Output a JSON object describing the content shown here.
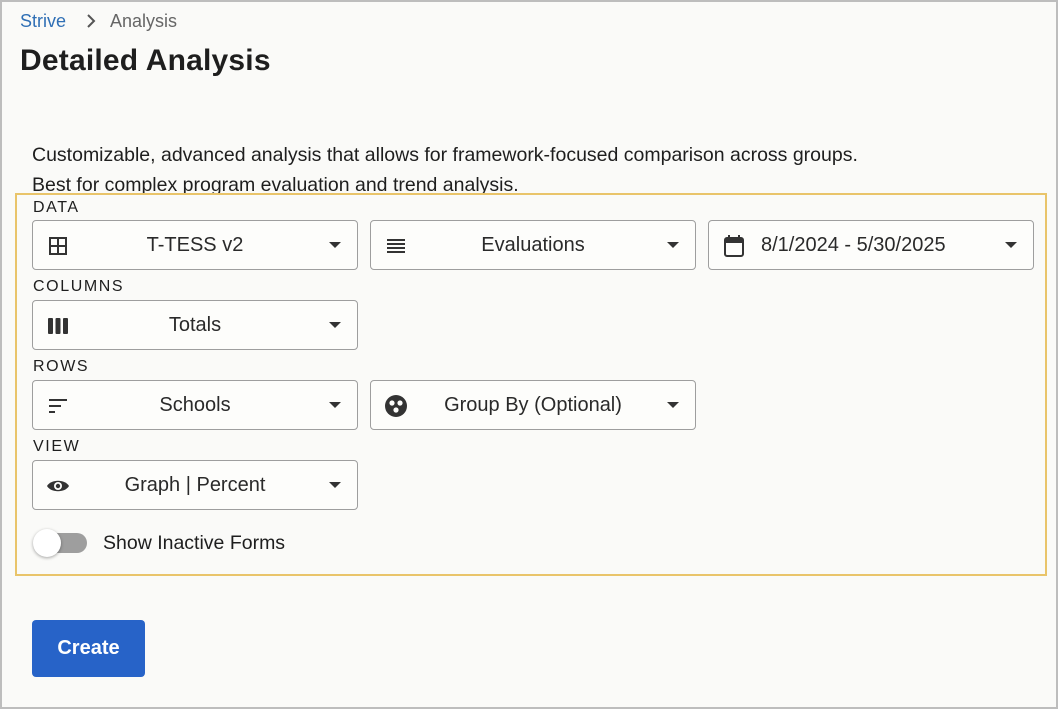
{
  "breadcrumb": {
    "root": "Strive",
    "current": "Analysis"
  },
  "page": {
    "title": "Detailed Analysis",
    "description_line1": "Customizable, advanced analysis that allows for framework-focused comparison across groups.",
    "description_line2": "Best for complex program evaluation and trend analysis."
  },
  "options": {
    "data": {
      "label": "DATA",
      "framework": {
        "value": "T-TESS v2",
        "icon": "grid-icon"
      },
      "type": {
        "value": "Evaluations",
        "icon": "list-lines-icon"
      },
      "date_range": {
        "value": "8/1/2024 - 5/30/2025",
        "icon": "calendar-icon"
      }
    },
    "columns": {
      "label": "COLUMNS",
      "value": "Totals",
      "icon": "columns-icon"
    },
    "rows": {
      "label": "ROWS",
      "value": "Schools",
      "icon": "sort-lines-icon",
      "group_by": {
        "value": "Group By (Optional)",
        "icon": "group-circle-icon"
      }
    },
    "view": {
      "label": "VIEW",
      "value": "Graph | Percent",
      "icon": "eye-icon"
    },
    "show_inactive": {
      "label": "Show Inactive Forms",
      "checked": false
    }
  },
  "actions": {
    "create_label": "Create"
  },
  "colors": {
    "accent": "#2763c8",
    "link": "#2f6fb5",
    "highlight_border": "#e9c46a"
  }
}
